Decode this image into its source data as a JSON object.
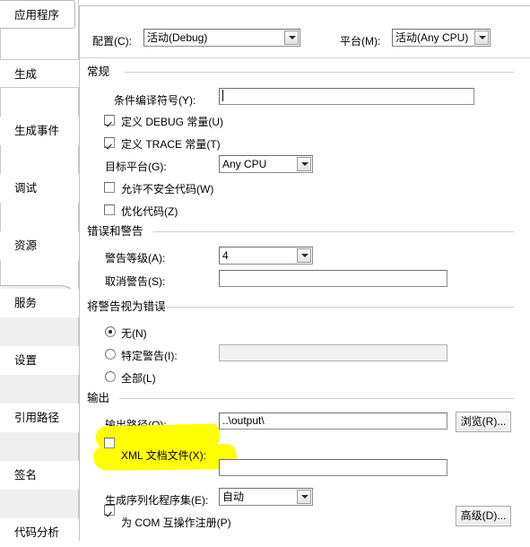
{
  "window": {
    "kind": "project-properties-build-tab"
  },
  "sidebar": {
    "tabs": [
      {
        "label": "应用程序",
        "selected": false,
        "boxed": true
      },
      {
        "label": "生成",
        "selected": true,
        "boxed": false
      },
      {
        "label": "生成事件",
        "selected": false,
        "boxed": false
      },
      {
        "label": "调试",
        "selected": false,
        "boxed": false
      },
      {
        "label": "资源",
        "selected": false,
        "boxed": false
      },
      {
        "label": "服务",
        "selected": false,
        "boxed": false
      },
      {
        "label": "设置",
        "selected": false,
        "boxed": false
      },
      {
        "label": "引用路径",
        "selected": false,
        "boxed": false
      },
      {
        "label": "签名",
        "selected": false,
        "boxed": false
      },
      {
        "label": "代码分析",
        "selected": false,
        "boxed": false
      }
    ]
  },
  "top": {
    "configuration_label": "配置(C):",
    "configuration_value": "活动(Debug)",
    "platform_label": "平台(M):",
    "platform_value": "活动(Any CPU)"
  },
  "general": {
    "group_label": "常规",
    "conditional_symbols_label": "条件编译符号(Y):",
    "conditional_symbols_value": "",
    "define_debug_label": "定义 DEBUG 常量(U)",
    "define_debug_checked": true,
    "define_trace_label": "定义 TRACE 常量(T)",
    "define_trace_checked": true,
    "target_platform_label": "目标平台(G):",
    "target_platform_value": "Any CPU",
    "allow_unsafe_label": "允许不安全代码(W)",
    "allow_unsafe_checked": false,
    "optimize_label": "优化代码(Z)",
    "optimize_checked": false
  },
  "errors": {
    "group_label": "错误和警告",
    "warning_level_label": "警告等级(A):",
    "warning_level_value": "4",
    "suppress_warnings_label": "取消警告(S):",
    "suppress_warnings_value": ""
  },
  "treat_warnings": {
    "group_label": "将警告视为错误",
    "none_label": "无(N)",
    "none_selected": true,
    "specific_label": "特定警告(I):",
    "specific_selected": false,
    "specific_value": "",
    "all_label": "全部(L)",
    "all_selected": false
  },
  "output": {
    "group_label": "输出",
    "output_path_label": "输出路径(O):",
    "output_path_value": "..\\output\\",
    "browse_button": "浏览(R)...",
    "xml_doc_label": "XML 文档文件(X):",
    "xml_doc_checked": false,
    "xml_doc_value": "",
    "com_interop_label": "为 COM 互操作注册(P)",
    "com_interop_checked": true,
    "serialization_label": "生成序列化程序集(E):",
    "serialization_value": "自动",
    "advanced_button": "高级(D)..."
  },
  "colors": {
    "highlight": "#ffff00",
    "panel_bg": "#ffffff",
    "sidebar_fill": "#efefef",
    "rule": "#cfcfcf"
  }
}
